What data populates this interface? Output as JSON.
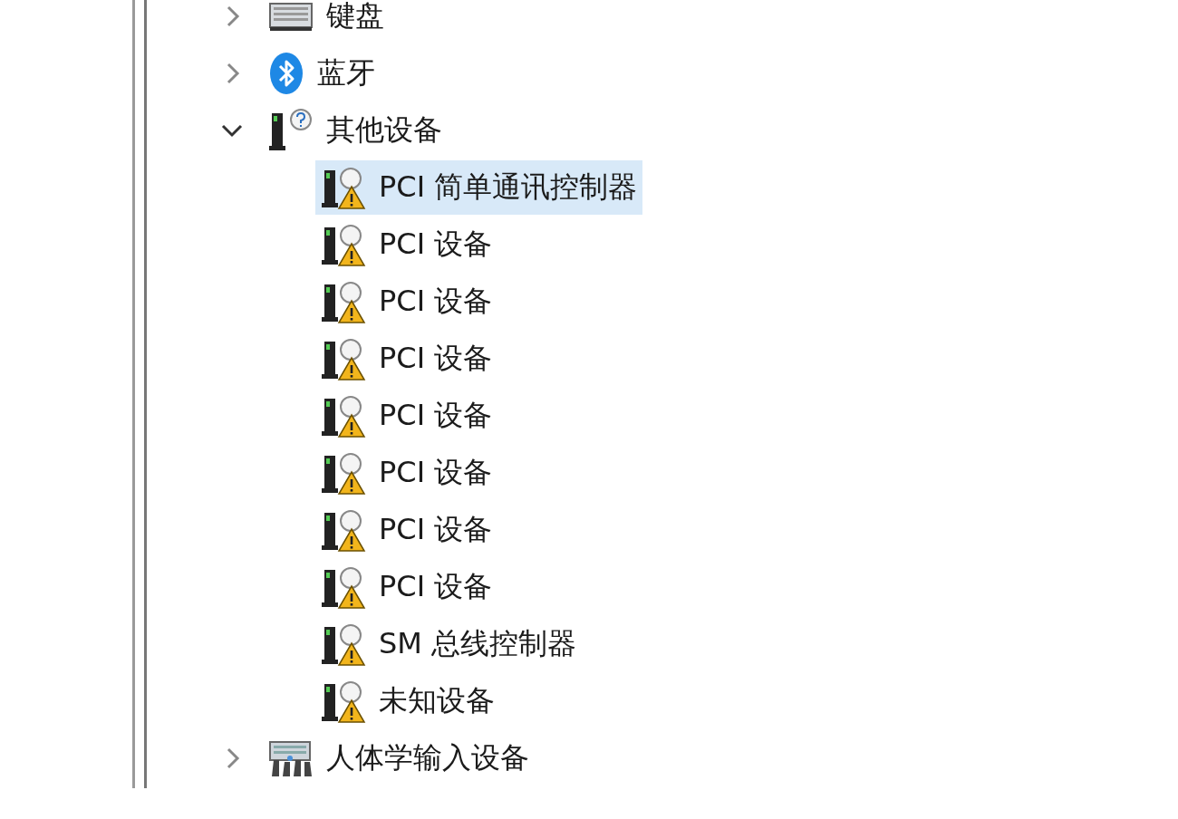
{
  "tree": [
    {
      "label": "键盘",
      "kind": "keyboard",
      "expanded": false
    },
    {
      "label": "蓝牙",
      "kind": "bluetooth",
      "expanded": false
    },
    {
      "label": "其他设备",
      "kind": "unknown",
      "expanded": true,
      "children": [
        {
          "label": "PCI 简单通讯控制器",
          "kind": "warning",
          "selected": true
        },
        {
          "label": "PCI 设备",
          "kind": "warning",
          "selected": false
        },
        {
          "label": "PCI 设备",
          "kind": "warning",
          "selected": false
        },
        {
          "label": "PCI 设备",
          "kind": "warning",
          "selected": false
        },
        {
          "label": "PCI 设备",
          "kind": "warning",
          "selected": false
        },
        {
          "label": "PCI 设备",
          "kind": "warning",
          "selected": false
        },
        {
          "label": "PCI 设备",
          "kind": "warning",
          "selected": false
        },
        {
          "label": "PCI 设备",
          "kind": "warning",
          "selected": false
        },
        {
          "label": "SM 总线控制器",
          "kind": "warning",
          "selected": false
        },
        {
          "label": "未知设备",
          "kind": "warning",
          "selected": false
        }
      ]
    },
    {
      "label": "人体学输入设备",
      "kind": "hid",
      "expanded": false
    }
  ]
}
